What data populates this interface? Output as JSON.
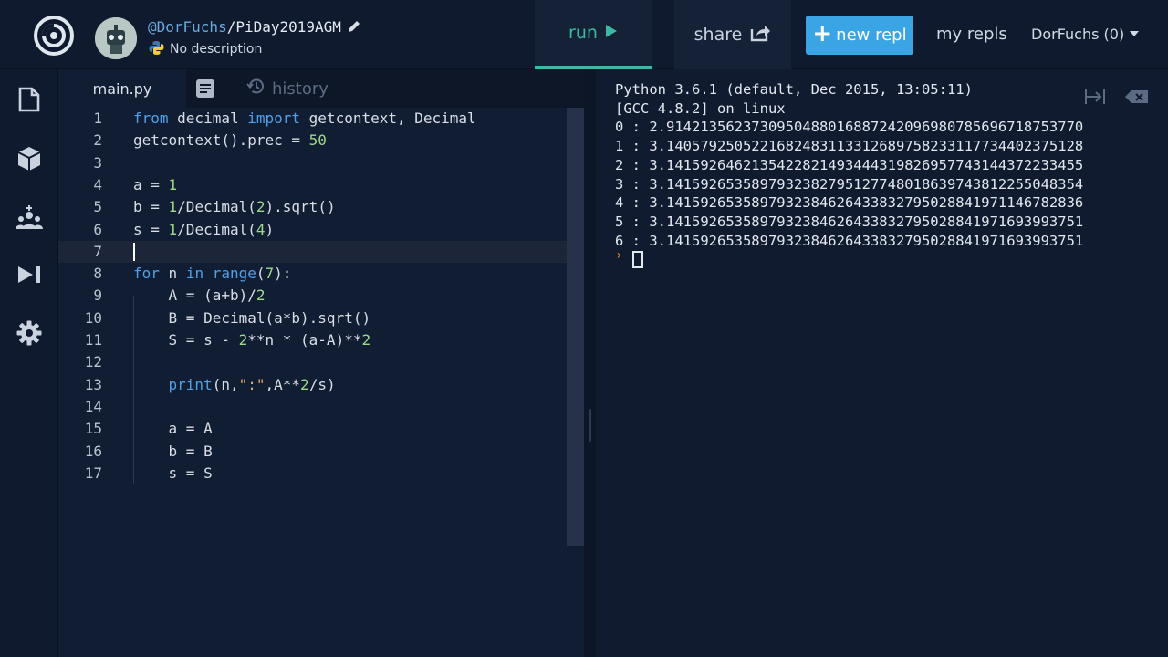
{
  "header": {
    "owner": "@DorFuchs",
    "separator": "/",
    "repl_name": "PiDay2019AGM",
    "description": "No description",
    "language_icon": "python-icon",
    "run_label": "run",
    "share_label": "share",
    "new_repl_label": "new repl",
    "my_repls_label": "my repls",
    "user_label": "DorFuchs (0)"
  },
  "sidebar": {
    "items": [
      {
        "icon": "files-icon"
      },
      {
        "icon": "packages-icon"
      },
      {
        "icon": "add-user-icon"
      },
      {
        "icon": "debugger-icon"
      },
      {
        "icon": "settings-icon"
      }
    ]
  },
  "editor": {
    "tabs": {
      "file": "main.py",
      "history": "history"
    },
    "active_line": 7,
    "lines": [
      {
        "n": "1",
        "code": "from decimal import getcontext, Decimal"
      },
      {
        "n": "2",
        "code": "getcontext().prec = 50"
      },
      {
        "n": "3",
        "code": ""
      },
      {
        "n": "4",
        "code": "a = 1"
      },
      {
        "n": "5",
        "code": "b = 1/Decimal(2).sqrt()"
      },
      {
        "n": "6",
        "code": "s = 1/Decimal(4)"
      },
      {
        "n": "7",
        "code": ""
      },
      {
        "n": "8",
        "code": "for n in range(7):"
      },
      {
        "n": "9",
        "code": "    A = (a+b)/2"
      },
      {
        "n": "10",
        "code": "    B = Decimal(a*b).sqrt()"
      },
      {
        "n": "11",
        "code": "    S = s - 2**n * (a-A)**2"
      },
      {
        "n": "12",
        "code": ""
      },
      {
        "n": "13",
        "code": "    print(n,\":\",A**2/s)"
      },
      {
        "n": "14",
        "code": ""
      },
      {
        "n": "15",
        "code": "    a = A"
      },
      {
        "n": "16",
        "code": "    b = B"
      },
      {
        "n": "17",
        "code": "    s = S"
      }
    ]
  },
  "console": {
    "lines": [
      "Python 3.6.1 (default, Dec 2015, 13:05:11)",
      "[GCC 4.8.2] on linux",
      "0 : 2.9142135623730950488016887242096980785696718753770",
      "1 : 3.1405792505221682483113312689758233117734402375128",
      "2 : 3.1415926462135422821493444319826957743144372233455",
      "3 : 3.1415926535897932382795127748018639743812255048354",
      "4 : 3.1415926535897932384626433832795028841971146782836",
      "5 : 3.1415926535897932384626433832795028841971693993751",
      "6 : 3.1415926535897932384626433832795028841971693993751"
    ],
    "prompt": "›"
  },
  "colors": {
    "accent_run": "#3fb7a5",
    "new_repl_bg": "#3aa5e4",
    "keyword": "#4fa0e8",
    "number": "#9fd88a",
    "string": "#e4a86a"
  }
}
